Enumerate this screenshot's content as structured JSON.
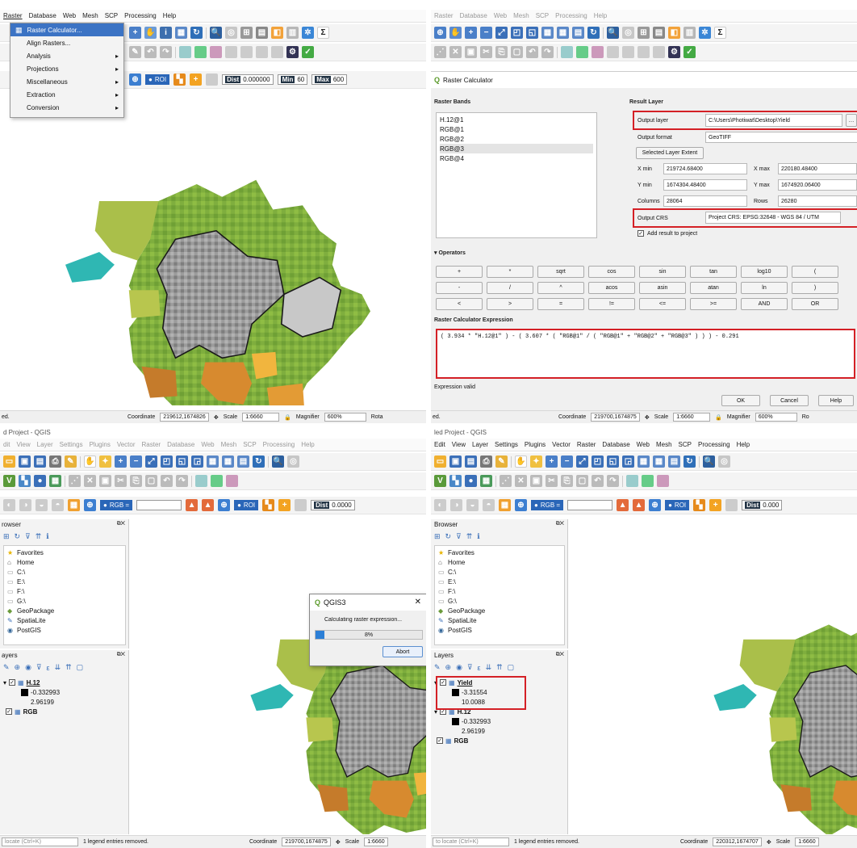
{
  "tl": {
    "menubar": [
      "Raster",
      "Database",
      "Web",
      "Mesh",
      "SCP",
      "Processing",
      "Help"
    ],
    "dropdown": [
      "Raster Calculator...",
      "Align Rasters...",
      "Analysis",
      "Projections",
      "Miscellaneous",
      "Extraction",
      "Conversion"
    ],
    "roi": "ROI",
    "dist_label": "Dist",
    "dist_value": "0.000000",
    "min_label": "Min",
    "min_value": "60",
    "max_label": "Max",
    "max_value": "600",
    "status_left": "ed.",
    "coord_label": "Coordinate",
    "coord_value": "219612,1674826",
    "scale_label": "Scale",
    "scale_value": "1:6660",
    "magnifier_label": "Magnifier",
    "magnifier_value": "600%",
    "rotation_label": "Rota"
  },
  "tr": {
    "menubar": [
      "Raster",
      "Database",
      "Web",
      "Mesh",
      "SCP",
      "Processing",
      "Help"
    ],
    "dialog_title": "Raster Calculator",
    "raster_bands_title": "Raster Bands",
    "bands": [
      "H.12@1",
      "RGB@1",
      "RGB@2",
      "RGB@3",
      "RGB@4"
    ],
    "result_layer_title": "Result Layer",
    "output_layer_label": "Output layer",
    "output_layer_value": "C:\\Users\\Photiwat\\Desktop\\Yield",
    "output_format_label": "Output format",
    "output_format_value": "GeoTIFF",
    "selected_extent_label": "Selected Layer Extent",
    "xmin_label": "X min",
    "xmin_value": "219724.68400",
    "xmax_label": "X max",
    "xmax_value": "220180.48400",
    "ymin_label": "Y min",
    "ymin_value": "1674304.48400",
    "ymax_label": "Y max",
    "ymax_value": "1674920.06400",
    "columns_label": "Columns",
    "columns_value": "28064",
    "rows_label": "Rows",
    "rows_value": "26280",
    "output_crs_label": "Output CRS",
    "output_crs_value": "Project CRS: EPSG:32648 - WGS 84 / UTM",
    "add_result_label": "Add result to project",
    "operators_title": "Operators",
    "operators": [
      [
        "+",
        "*",
        "sqrt",
        "cos",
        "sin",
        "tan",
        "log10",
        "("
      ],
      [
        "-",
        "/",
        "^",
        "acos",
        "asin",
        "atan",
        "ln",
        ")"
      ],
      [
        "<",
        ">",
        "=",
        "!=",
        "<=",
        ">=",
        "AND",
        "OR"
      ]
    ],
    "expression_title": "Raster Calculator Expression",
    "expression": "( 3.934 * \"H.12@1\" ) - ( 3.607 * ( \"RGB@1\" / ( \"RGB@1\" + \"RGB@2\" + \"RGB@3\" ) ) ) - 0.291",
    "expression_status": "Expression valid",
    "ok_label": "OK",
    "cancel_label": "Cancel",
    "help_label": "Help",
    "status_left": "ed.",
    "coord_label": "Coordinate",
    "coord_value": "219700,1674875",
    "scale_label": "Scale",
    "scale_value": "1:6660",
    "magnifier_label": "Magnifier",
    "magnifier_value": "600%",
    "rotation_label": "Ro"
  },
  "bl": {
    "title": "d Project - QGIS",
    "menubar": [
      "dit",
      "View",
      "Layer",
      "Settings",
      "Plugins",
      "Vector",
      "Raster",
      "Database",
      "Web",
      "Mesh",
      "SCP",
      "Processing",
      "Help"
    ],
    "rgb_label": "RGB =",
    "roi": "ROI",
    "dist_label": "Dist",
    "dist_value": "0.0000",
    "browser_title": "rowser",
    "browser_items": [
      "Favorites",
      "Home",
      "C:\\",
      "E:\\",
      "F:\\",
      "G:\\",
      "GeoPackage",
      "SpatiaLite",
      "PostGIS"
    ],
    "layers_title": "ayers",
    "layers": [
      {
        "name": "H.12",
        "min": "-0.332993",
        "max": "2.96199"
      },
      {
        "name": "RGB"
      }
    ],
    "dialog_title": "QGIS3",
    "dialog_message": "Calculating raster expression...",
    "progress": 0.08,
    "progress_text": "8%",
    "abort_label": "Abort",
    "status_locate": "locate (Ctrl+K)",
    "status_msg": "1 legend entries removed.",
    "coord_label": "Coordinate",
    "coord_value": "219700,1674875",
    "scale_label": "Scale",
    "scale_value": "1:6660"
  },
  "br": {
    "title": "led Project - QGIS",
    "menubar": [
      "Edit",
      "View",
      "Layer",
      "Settings",
      "Plugins",
      "Vector",
      "Raster",
      "Database",
      "Web",
      "Mesh",
      "SCP",
      "Processing",
      "Help"
    ],
    "rgb_label": "RGB =",
    "roi": "ROI",
    "dist_label": "Dist",
    "dist_value": "0.000",
    "browser_title": "Browser",
    "browser_items": [
      "Favorites",
      "Home",
      "C:\\",
      "E:\\",
      "F:\\",
      "G:\\",
      "GeoPackage",
      "SpatiaLite",
      "PostGIS"
    ],
    "layers_title": "Layers",
    "layers": [
      {
        "name": "Yield",
        "min": "-3.31554",
        "max": "10.0088"
      },
      {
        "name": "H.12",
        "min": "-0.332993",
        "max": "2.96199"
      },
      {
        "name": "RGB"
      }
    ],
    "status_locate": "to locate (Ctrl+K)",
    "status_msg": "1 legend entries removed.",
    "coord_label": "Coordinate",
    "coord_value": "220312,1674707",
    "scale_label": "Scale",
    "scale_value": "1:6660"
  },
  "colors": {
    "highlight_box": "#d42026",
    "menu_highlight": "#3b73c4",
    "progress": "#2c7fd6"
  },
  "icons": [
    "save-icon",
    "open-icon",
    "pan-icon",
    "zoom-in-icon",
    "zoom-out-icon",
    "refresh-icon",
    "identify-icon",
    "sum-icon",
    "settings-icon",
    "checkmark-icon",
    "close-icon"
  ]
}
